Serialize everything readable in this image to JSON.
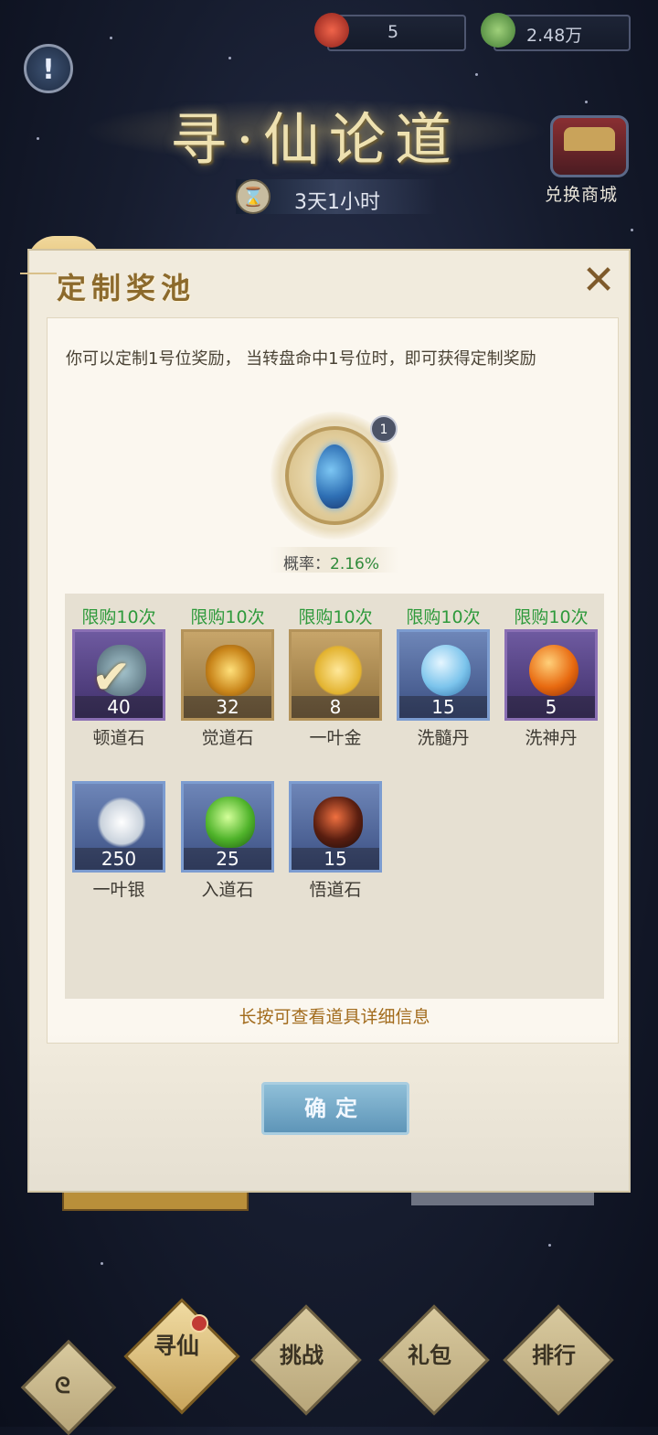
{
  "topbar": {
    "currency1": {
      "icon": "flame-talisman-icon",
      "value": "5"
    },
    "currency2": {
      "icon": "jade-coin-icon",
      "value": "2.48万"
    }
  },
  "header": {
    "event_title": "寻·仙论道",
    "timer": "3天1小时",
    "shop_label": "兑换商城"
  },
  "dialog": {
    "title": "定制奖池",
    "description": "你可以定制1号位奖励， 当转盘命中1号位时，即可获得定制奖励",
    "slot_badge": "1",
    "rate_label": "概率：",
    "rate_value": "2.16%",
    "hint": "长按可查看道具详细信息",
    "confirm_label": "确定",
    "items": [
      {
        "limit": "限购10次",
        "count": "40",
        "name": "顿道石",
        "rarity": "purple",
        "selected": true
      },
      {
        "limit": "限购10次",
        "count": "32",
        "name": "觉道石",
        "rarity": "gold",
        "selected": false
      },
      {
        "limit": "限购10次",
        "count": "8",
        "name": "一叶金",
        "rarity": "gold",
        "selected": false
      },
      {
        "limit": "限购10次",
        "count": "15",
        "name": "洗髓丹",
        "rarity": "blue",
        "selected": false
      },
      {
        "limit": "限购10次",
        "count": "5",
        "name": "洗神丹",
        "rarity": "purple",
        "selected": false
      },
      {
        "limit": "",
        "count": "250",
        "name": "一叶银",
        "rarity": "blue",
        "selected": false
      },
      {
        "limit": "",
        "count": "25",
        "name": "入道石",
        "rarity": "blue",
        "selected": false
      },
      {
        "limit": "",
        "count": "15",
        "name": "悟道石",
        "rarity": "blue",
        "selected": false
      }
    ]
  },
  "bottom_nav": [
    {
      "label": "",
      "icon": "swirl-icon"
    },
    {
      "label": "寻仙",
      "icon": "",
      "active": true
    },
    {
      "label": "挑战",
      "icon": ""
    },
    {
      "label": "礼包",
      "icon": ""
    },
    {
      "label": "排行",
      "icon": ""
    }
  ]
}
